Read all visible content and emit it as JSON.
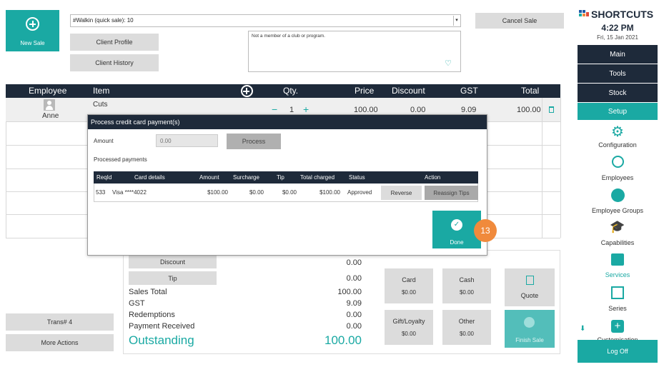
{
  "top": {
    "new_sale_label": "New Sale",
    "client_select_value": "#Walkin (quick sale): 10",
    "client_profile_label": "Client Profile",
    "client_history_label": "Client History",
    "notes_text": "Not a member of a club or program.",
    "cancel_sale_label": "Cancel Sale"
  },
  "table": {
    "headers": {
      "employee": "Employee",
      "item": "Item",
      "qty": "Qty.",
      "price": "Price",
      "discount": "Discount",
      "gst": "GST",
      "total": "Total"
    },
    "row": {
      "employee": "Anne",
      "item": "Cuts",
      "qty": "1",
      "price": "100.00",
      "discount": "0.00",
      "gst": "9.09",
      "total": "100.00"
    }
  },
  "modal": {
    "title": "Process credit card payment(s)",
    "amount_label": "Amount",
    "amount_placeholder": "0.00",
    "process_label": "Process",
    "processed_label": "Processed payments",
    "columns": [
      "ReqId",
      "Card details",
      "Amount",
      "Surcharge",
      "Tip",
      "Total charged",
      "Status",
      "Action"
    ],
    "payment": {
      "reqid": "533",
      "card": "Visa ****4022",
      "amount": "$100.00",
      "surcharge": "$0.00",
      "tip": "$0.00",
      "total_charged": "$100.00",
      "status": "Approved",
      "reverse_label": "Reverse",
      "reassign_label": "Reassign Tips"
    },
    "done_label": "Done",
    "step_badge": "13"
  },
  "summary": {
    "discount_label": "Discount",
    "discount_value": "0.00",
    "tip_label": "Tip",
    "tip_value": "0.00",
    "sales_total_label": "Sales Total",
    "sales_total_value": "100.00",
    "gst_label": "GST",
    "gst_value": "9.09",
    "redemptions_label": "Redemptions",
    "redemptions_value": "0.00",
    "payment_received_label": "Payment Received",
    "payment_received_value": "0.00",
    "outstanding_label": "Outstanding",
    "outstanding_value": "100.00"
  },
  "payments": {
    "card_label": "Card",
    "card_value": "$0.00",
    "cash_label": "Cash",
    "cash_value": "$0.00",
    "gift_label": "Gift/Loyalty",
    "gift_value": "$0.00",
    "other_label": "Other",
    "other_value": "$0.00",
    "quote_label": "Quote",
    "finish_label": "Finish Sale"
  },
  "left_actions": {
    "trans_label": "Trans# 4",
    "more_actions_label": "More Actions"
  },
  "sidebar": {
    "brand": "SHORTCUTS",
    "time": "4:22 PM",
    "date": "Fri, 15 Jan 2021",
    "menu": [
      "Main",
      "Tools",
      "Stock",
      "Setup"
    ],
    "items": [
      "Configuration",
      "Employees",
      "Employee Groups",
      "Capabilities",
      "Services",
      "Series",
      "Customisation"
    ],
    "logoff_label": "Log Off"
  },
  "colors": {
    "teal": "#1aa9a3",
    "dark_navy": "#1e2a3a",
    "badge_orange": "#f08a3c",
    "outstanding_teal": "#1aa9a3"
  }
}
